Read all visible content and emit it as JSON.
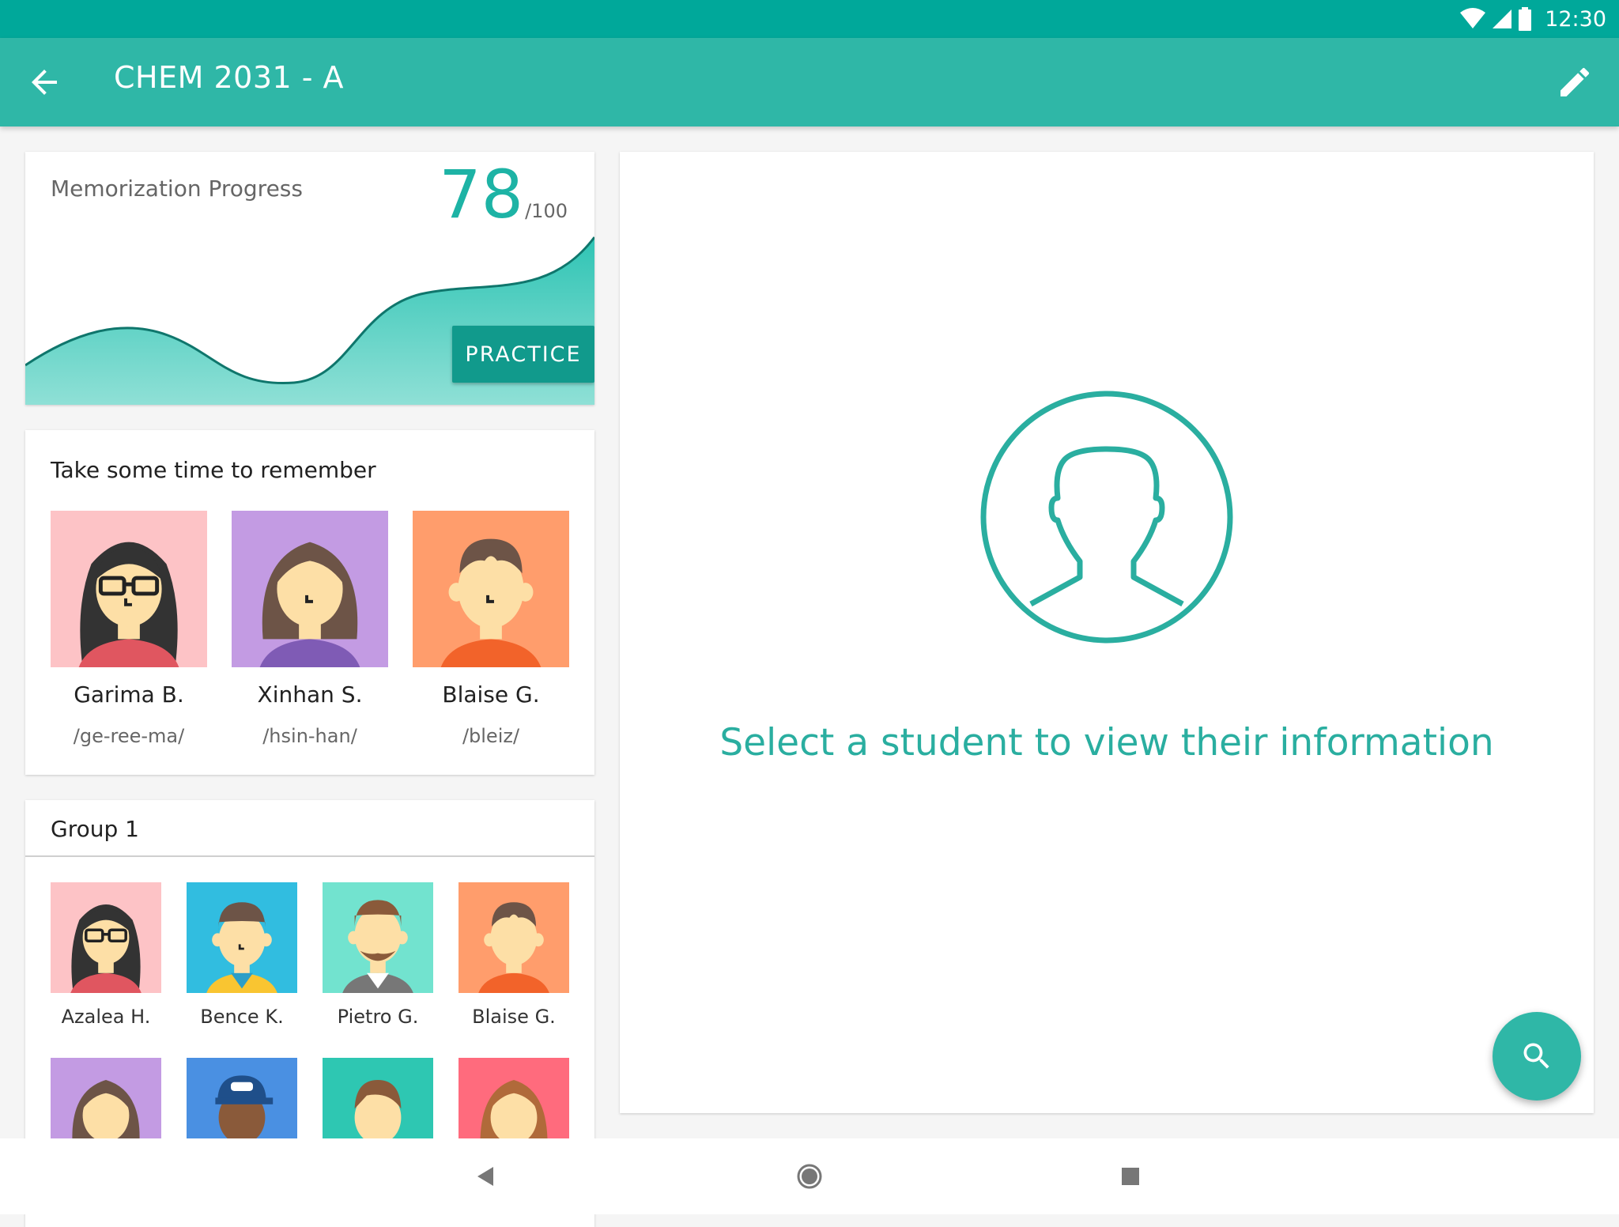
{
  "status_bar": {
    "time": "12:30"
  },
  "app_bar": {
    "title": "CHEM 2031 - A"
  },
  "progress_card": {
    "label": "Memorization Progress",
    "value": "78",
    "max": "/100",
    "practice_label": "PRACTICE"
  },
  "remember_card": {
    "title": "Take some time to remember",
    "students": [
      {
        "name": "Garima B.",
        "pronunciation": "/ge-ree-ma/"
      },
      {
        "name": "Xinhan S.",
        "pronunciation": "/hsin-han/"
      },
      {
        "name": "Blaise G.",
        "pronunciation": "/bleiz/"
      }
    ]
  },
  "group_card": {
    "title": "Group 1",
    "students": [
      {
        "name": "Azalea H."
      },
      {
        "name": "Bence K."
      },
      {
        "name": "Pietro G."
      },
      {
        "name": "Blaise G."
      }
    ]
  },
  "detail": {
    "placeholder": "Select a student to view their information"
  },
  "colors": {
    "status_bar": "#00a89a",
    "app_bar": "#2fb7a7",
    "accent": "#1db3a5",
    "practice_button": "#119a8c"
  },
  "icons": {
    "back": "arrow-back-icon",
    "edit": "pencil-icon",
    "search": "search-icon",
    "placeholder": "person-icon"
  }
}
